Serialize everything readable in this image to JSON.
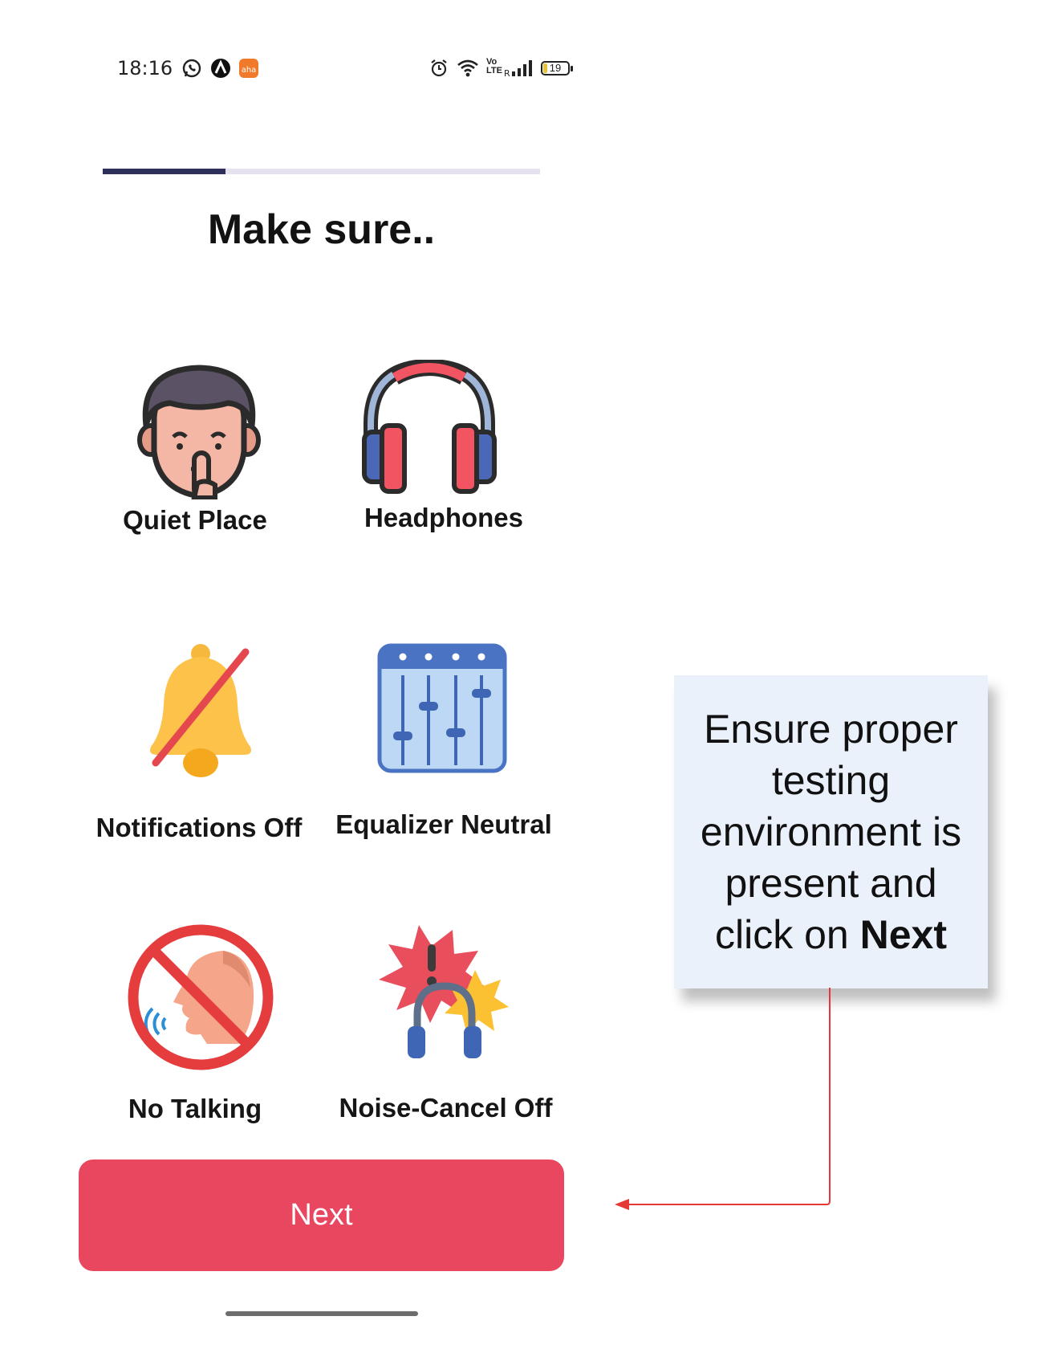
{
  "status_bar": {
    "time": "18:16",
    "left_icons": [
      "whatsapp-icon",
      "app-a-icon",
      "aha-app-icon"
    ],
    "right_icons": [
      "alarm-icon",
      "wifi-icon",
      "volte-icon",
      "signal-icon"
    ],
    "volte_label": "Vo\nLTE",
    "battery_level": "19"
  },
  "progress": {
    "fraction": 0.28,
    "track_color": "#e6e1ee",
    "fill_color": "#2d2f5a"
  },
  "page_title": "Make sure..",
  "items": [
    {
      "label": "Quiet Place",
      "icon": "quiet-person-icon"
    },
    {
      "label": "Headphones",
      "icon": "headphones-icon"
    },
    {
      "label": "Notifications Off",
      "icon": "bell-off-icon"
    },
    {
      "label": "Equalizer Neutral",
      "icon": "equalizer-icon"
    },
    {
      "label": "No Talking",
      "icon": "no-talking-icon"
    },
    {
      "label": "Noise-Cancel Off",
      "icon": "noise-cancel-headphones-icon"
    }
  ],
  "next_button": {
    "label": "Next",
    "color": "#e94760"
  },
  "callout": {
    "text_before": "Ensure proper testing environment is present and click on ",
    "text_bold": "Next",
    "arrow_color": "#e53935"
  }
}
